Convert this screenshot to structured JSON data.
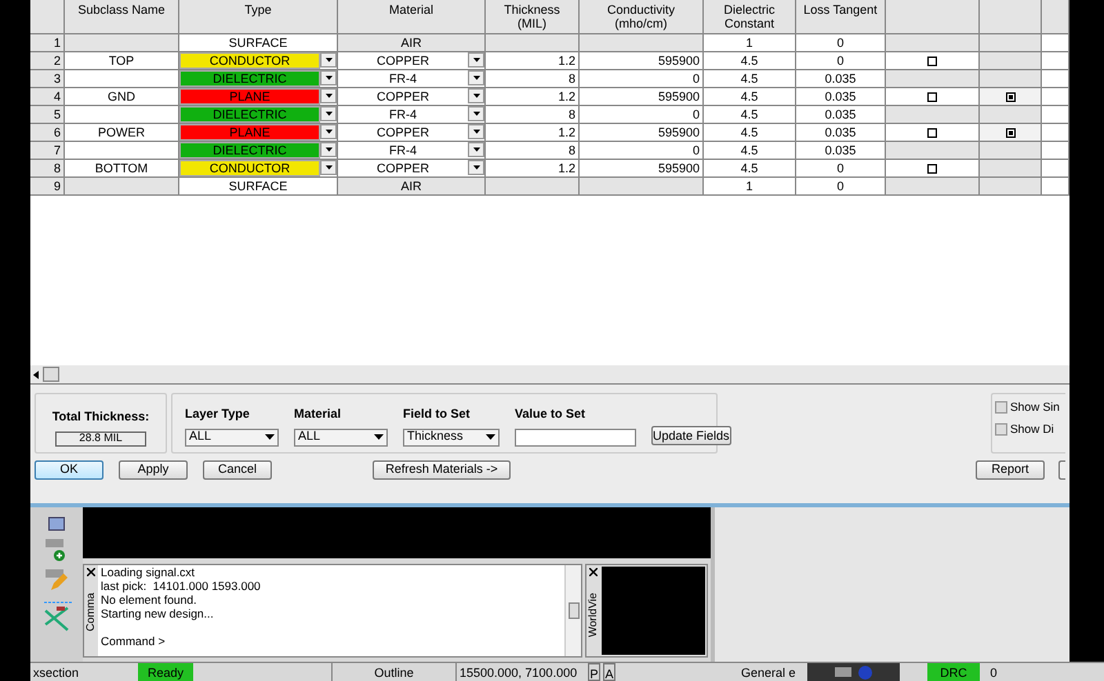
{
  "table": {
    "columns": [
      "Subclass Name",
      "Type",
      "Material",
      "Thickness (MIL)",
      "Conductivity (mho/cm)",
      "Dielectric Constant",
      "Loss Tangent"
    ],
    "rows": [
      {
        "num": "1",
        "kind": "surface",
        "subclass": "",
        "type": {
          "label": "SURFACE",
          "color": "#ffffff"
        },
        "material": "AIR",
        "thickness": "",
        "conductivity": "",
        "dk": "1",
        "loss": "0"
      },
      {
        "num": "2",
        "kind": "layer",
        "subclass": "TOP",
        "type": {
          "label": "CONDUCTOR",
          "color": "#f2e600"
        },
        "material": "COPPER",
        "thickness": "1.2",
        "conductivity": "595900",
        "dk": "4.5",
        "loss": "0",
        "check_a": false
      },
      {
        "num": "3",
        "kind": "layer",
        "subclass": "",
        "type": {
          "label": "DIELECTRIC",
          "color": "#10b010"
        },
        "material": "FR-4",
        "thickness": "8",
        "conductivity": "0",
        "dk": "4.5",
        "loss": "0.035"
      },
      {
        "num": "4",
        "kind": "layer",
        "subclass": "GND",
        "type": {
          "label": "PLANE",
          "color": "#ff0000"
        },
        "material": "COPPER",
        "thickness": "1.2",
        "conductivity": "595900",
        "dk": "4.5",
        "loss": "0.035",
        "check_a": false,
        "check_b": true
      },
      {
        "num": "5",
        "kind": "layer",
        "subclass": "",
        "type": {
          "label": "DIELECTRIC",
          "color": "#10b010"
        },
        "material": "FR-4",
        "thickness": "8",
        "conductivity": "0",
        "dk": "4.5",
        "loss": "0.035"
      },
      {
        "num": "6",
        "kind": "layer",
        "subclass": "POWER",
        "type": {
          "label": "PLANE",
          "color": "#ff0000"
        },
        "material": "COPPER",
        "thickness": "1.2",
        "conductivity": "595900",
        "dk": "4.5",
        "loss": "0.035",
        "check_a": false,
        "check_b": true
      },
      {
        "num": "7",
        "kind": "layer",
        "subclass": "",
        "type": {
          "label": "DIELECTRIC",
          "color": "#10b010"
        },
        "material": "FR-4",
        "thickness": "8",
        "conductivity": "0",
        "dk": "4.5",
        "loss": "0.035"
      },
      {
        "num": "8",
        "kind": "layer",
        "subclass": "BOTTOM",
        "type": {
          "label": "CONDUCTOR",
          "color": "#f2e600"
        },
        "material": "COPPER",
        "thickness": "1.2",
        "conductivity": "595900",
        "dk": "4.5",
        "loss": "0",
        "check_a": false
      },
      {
        "num": "9",
        "kind": "surface",
        "subclass": "",
        "type": {
          "label": "SURFACE",
          "color": "#ffffff"
        },
        "material": "AIR",
        "thickness": "",
        "conductivity": "",
        "dk": "1",
        "loss": "0"
      }
    ]
  },
  "total": {
    "label": "Total Thickness:",
    "value": "28.8 MIL"
  },
  "filters": [
    {
      "label": "Layer Type",
      "value": "ALL"
    },
    {
      "label": "Material",
      "value": "ALL"
    },
    {
      "label": "Field to Set",
      "value": "Thickness"
    }
  ],
  "value_to_set": {
    "label": "Value to Set"
  },
  "update_button": "Update Fields",
  "show_options": [
    {
      "label": "Show Sin",
      "checked": false
    },
    {
      "label": "Show Di",
      "checked": false
    }
  ],
  "buttons": [
    {
      "label": "OK",
      "default": true
    },
    {
      "label": "Apply",
      "default": false
    },
    {
      "label": "Cancel",
      "default": false
    }
  ],
  "refresh_button": "Refresh Materials ->",
  "report_button": "Report",
  "command": {
    "tab": "Comma",
    "lines": [
      "Loading signal.cxt",
      "last pick:  14101.000 1593.000",
      "No element found.",
      "Starting new design..."
    ],
    "prompt": "Command >"
  },
  "worldview": {
    "tab": "WorldVie"
  },
  "status": {
    "command": "xsection",
    "state": "Ready",
    "mode": "Outline",
    "coords": "15500.000, 7100.000",
    "p": "P",
    "a": "A",
    "general": "General e",
    "drc": "DRC",
    "count": "0"
  }
}
